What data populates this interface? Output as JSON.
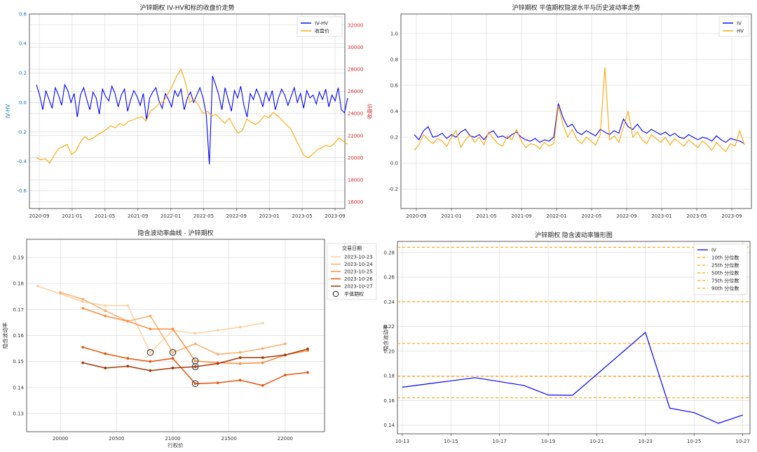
{
  "chart_data": [
    {
      "type": "line",
      "title": "沪锌期权 IV-HV和标的收盘价走势",
      "ylabel_left": "IV-HV",
      "ylabel_right": "收盘价",
      "ylim_left": [
        -0.72,
        0.6
      ],
      "ylim_right": [
        15400,
        33000
      ],
      "yticks_left": [
        -0.6,
        -0.4,
        -0.2,
        0.0,
        0.2,
        0.4,
        0.6
      ],
      "yticks_right": [
        16000,
        18000,
        20000,
        22000,
        24000,
        26000,
        28000,
        30000,
        32000
      ],
      "xticks": [
        "2020-09",
        "2021-01",
        "2021-05",
        "2021-09",
        "2022-01",
        "2022-05",
        "2022-09",
        "2023-01",
        "2023-05",
        "2023-09"
      ],
      "colors": {
        "left_axis": "#1f77b4",
        "right_axis": "#d62728"
      },
      "legend": "top-right",
      "grid": true,
      "series": [
        {
          "name": "IV-HV",
          "color": "#0000ff",
          "axis": "left",
          "values": [
            0.12,
            0.05,
            -0.05,
            0.08,
            0.02,
            -0.04,
            0.1,
            0.05,
            -0.02,
            0.12,
            0.08,
            0.0,
            0.06,
            -0.1,
            0.05,
            0.1,
            0.02,
            -0.05,
            0.07,
            0.03,
            -0.08,
            0.09,
            0.04,
            0.01,
            0.11,
            0.06,
            -0.03,
            0.05,
            0.09,
            -0.06,
            0.02,
            0.08,
            0.04,
            -0.02,
            0.06,
            -0.12,
            0.03,
            0.07,
            0.1,
            0.01,
            -0.04,
            0.06,
            0.02,
            -0.03,
            0.08,
            0.04,
            0.09,
            -0.05,
            0.03,
            0.07,
            0.0,
            0.05,
            0.1,
            0.03,
            -0.08,
            -0.42,
            0.18,
            0.12,
            0.05,
            -0.05,
            0.1,
            0.02,
            -0.06,
            0.08,
            0.03,
            0.11,
            -0.02,
            -0.1,
            0.06,
            0.02,
            0.09,
            0.04,
            -0.03,
            0.07,
            0.01,
            0.08,
            -0.05,
            0.03,
            0.09,
            0.05,
            -0.02,
            0.04,
            0.1,
            0.0,
            0.06,
            -0.04,
            0.08,
            0.03,
            0.05,
            -0.01,
            0.07,
            0.02,
            0.09,
            -0.03,
            0.05,
            0.01,
            0.1,
            -0.05,
            -0.07,
            0.03
          ]
        },
        {
          "name": "收盘价",
          "color": "#ffa500",
          "axis": "right",
          "values": [
            20000,
            19800,
            19900,
            19500,
            20200,
            20800,
            21000,
            21200,
            20300,
            20600,
            21400,
            21900,
            21600,
            21800,
            22100,
            22300,
            22600,
            22900,
            22700,
            23100,
            22900,
            23300,
            23400,
            23600,
            23700,
            23300,
            24200,
            24500,
            24900,
            25100,
            25800,
            26500,
            27400,
            28000,
            26800,
            25000,
            25300,
            24700,
            24000,
            24200,
            23800,
            23900,
            23500,
            23100,
            23600,
            22800,
            22200,
            22500,
            23500,
            23200,
            23000,
            23300,
            23800,
            23600,
            24100,
            23800,
            23400,
            23000,
            22600,
            21800,
            21000,
            20200,
            20000,
            20300,
            20700,
            20900,
            21100,
            21000,
            21300,
            21800,
            21500,
            21200
          ]
        }
      ]
    },
    {
      "type": "line",
      "title": "沪锌期权 平值期权隐波水平与历史波动率走势",
      "ylim": [
        -0.35,
        1.15
      ],
      "yticks": [
        -0.2,
        0.0,
        0.2,
        0.4,
        0.6,
        0.8,
        1.0
      ],
      "xticks": [
        "2020-09",
        "2021-01",
        "2021-05",
        "2021-09",
        "2022-01",
        "2022-05",
        "2022-09",
        "2023-01",
        "2023-05",
        "2023-09"
      ],
      "legend": "top-right",
      "grid": true,
      "series": [
        {
          "name": "IV",
          "color": "#0000ff",
          "values": [
            0.22,
            0.18,
            0.25,
            0.28,
            0.2,
            0.21,
            0.23,
            0.19,
            0.22,
            0.2,
            0.24,
            0.26,
            0.21,
            0.2,
            0.22,
            0.18,
            0.23,
            0.25,
            0.2,
            0.21,
            0.19,
            0.22,
            0.24,
            0.2,
            0.18,
            0.17,
            0.19,
            0.16,
            0.18,
            0.17,
            0.2,
            0.46,
            0.35,
            0.28,
            0.3,
            0.24,
            0.22,
            0.25,
            0.23,
            0.21,
            0.26,
            0.24,
            0.22,
            0.25,
            0.23,
            0.34,
            0.28,
            0.26,
            0.3,
            0.25,
            0.23,
            0.26,
            0.24,
            0.22,
            0.24,
            0.21,
            0.23,
            0.2,
            0.19,
            0.22,
            0.2,
            0.18,
            0.2,
            0.19,
            0.17,
            0.21,
            0.18,
            0.16,
            0.19,
            0.18,
            0.17,
            0.15
          ]
        },
        {
          "name": "HV",
          "color": "#ffa500",
          "values": [
            0.1,
            0.14,
            0.22,
            0.18,
            0.15,
            0.19,
            0.17,
            0.13,
            0.2,
            0.25,
            0.12,
            0.18,
            0.22,
            0.16,
            0.2,
            0.14,
            0.24,
            0.19,
            0.15,
            0.13,
            0.21,
            0.18,
            0.26,
            0.17,
            0.12,
            0.15,
            0.14,
            0.11,
            0.16,
            0.13,
            0.15,
            0.44,
            0.3,
            0.2,
            0.26,
            0.18,
            0.15,
            0.2,
            0.17,
            0.14,
            0.22,
            0.74,
            0.18,
            0.21,
            0.16,
            0.28,
            0.4,
            0.2,
            0.24,
            0.18,
            0.15,
            0.22,
            0.19,
            0.16,
            0.2,
            0.14,
            0.19,
            0.16,
            0.13,
            0.18,
            0.15,
            0.12,
            0.17,
            0.14,
            0.1,
            0.16,
            0.12,
            0.09,
            0.15,
            0.13,
            0.25,
            0.14
          ]
        }
      ]
    },
    {
      "type": "line",
      "title": "隐含波动率曲线 - 沪锌期权",
      "xlabel": "行权价",
      "ylabel": "隐含波动率",
      "xlim": [
        19700,
        22350
      ],
      "ylim": [
        0.123,
        0.197
      ],
      "xticks": [
        20000,
        20500,
        21000,
        21500,
        22000
      ],
      "yticks": [
        0.13,
        0.14,
        0.15,
        0.16,
        0.17,
        0.18,
        0.19
      ],
      "legend_title": "交易日期",
      "legend_atm": "平值期权",
      "legend": "top-right",
      "grid": true,
      "series": [
        {
          "name": "2023-10-23",
          "color": "#fdd0a2",
          "x": [
            19800,
            20000,
            20200,
            20400,
            20600,
            20800,
            21000,
            21200,
            21400,
            21600,
            21800
          ],
          "values": [
            0.179,
            0.176,
            0.173,
            0.1715,
            0.1715,
            0.1535,
            0.162,
            0.1608,
            0.162,
            0.1632,
            0.1648
          ],
          "atm": [
            20800,
            0.1535
          ]
        },
        {
          "name": "2023-10-24",
          "color": "#fdae6b",
          "x": [
            20000,
            20200,
            20400,
            20600,
            20800,
            21000,
            21200,
            21400,
            21600,
            21800,
            22000
          ],
          "values": [
            0.1765,
            0.174,
            0.1695,
            0.1655,
            0.1675,
            0.1535,
            0.1568,
            0.1528,
            0.1535,
            0.155,
            0.1568
          ],
          "atm": [
            21000,
            0.1535
          ]
        },
        {
          "name": "2023-10-25",
          "color": "#fd8d3c",
          "x": [
            20200,
            20400,
            20600,
            20800,
            21000,
            21200,
            21400,
            21600,
            21800,
            22000,
            22200
          ],
          "values": [
            0.1705,
            0.1675,
            0.1655,
            0.1625,
            0.1625,
            0.1502,
            0.1495,
            0.1492,
            0.1495,
            0.1525,
            0.1542
          ],
          "atm": [
            21200,
            0.1502
          ]
        },
        {
          "name": "2023-10-26",
          "color": "#e6550d",
          "x": [
            20200,
            20400,
            20600,
            20800,
            21000,
            21200,
            21400,
            21600,
            21800,
            22000,
            22200
          ],
          "values": [
            0.1555,
            0.153,
            0.1512,
            0.15,
            0.1512,
            0.1415,
            0.1418,
            0.1428,
            0.1408,
            0.1448,
            0.1458
          ],
          "atm": [
            21200,
            0.1415
          ]
        },
        {
          "name": "2023-10-27",
          "color": "#a63603",
          "x": [
            20200,
            20400,
            20600,
            20800,
            21000,
            21200,
            21400,
            21600,
            21800,
            22000,
            22200
          ],
          "values": [
            0.1495,
            0.1475,
            0.1482,
            0.1465,
            0.1475,
            0.148,
            0.1492,
            0.1515,
            0.1515,
            0.1525,
            0.1548
          ],
          "atm": [
            21200,
            0.148
          ]
        }
      ]
    },
    {
      "type": "line",
      "title": "沪锌期权 隐含波动率锥形图",
      "ylabel": "隐含波动率",
      "xlim": [
        12.8,
        27.3
      ],
      "ylim": [
        0.133,
        0.289
      ],
      "xticks": [
        "10-13",
        "10-15",
        "10-17",
        "10-19",
        "10-21",
        "10-23",
        "10-25",
        "10-27"
      ],
      "xtick_days": [
        13,
        15,
        17,
        19,
        21,
        23,
        25,
        27
      ],
      "yticks": [
        0.14,
        0.16,
        0.18,
        0.2,
        0.22,
        0.24,
        0.26,
        0.28
      ],
      "legend": "top-right",
      "grid": true,
      "series": [
        {
          "name": "IV",
          "color": "#0000ff",
          "x": [
            13,
            16,
            18,
            19,
            20,
            23,
            24,
            25,
            26,
            27
          ],
          "values": [
            0.1708,
            0.1785,
            0.1722,
            0.1645,
            0.1642,
            0.2152,
            0.1538,
            0.1502,
            0.1415,
            0.1482
          ]
        }
      ],
      "percentiles": [
        {
          "name": "10th 分位数",
          "value": 0.1622
        },
        {
          "name": "25th 分位数",
          "value": 0.1795
        },
        {
          "name": "50th 分位数",
          "value": 0.2062
        },
        {
          "name": "75th 分位数",
          "value": 0.2402
        },
        {
          "name": "90th 分位数",
          "value": 0.2842
        }
      ],
      "percentile_color": "#ffa500"
    }
  ]
}
